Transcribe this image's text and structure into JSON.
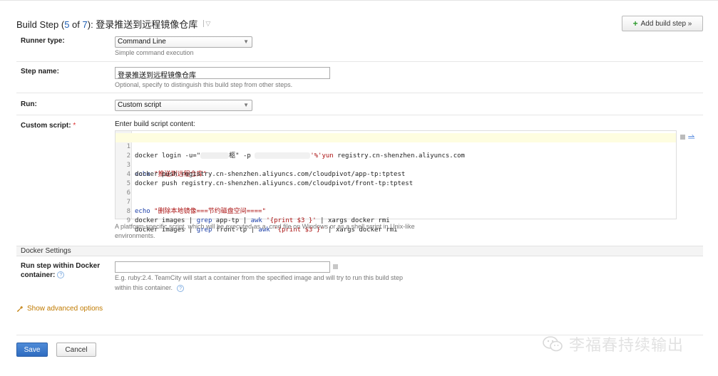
{
  "header": {
    "title_prefix": "Build Step (",
    "current_step": "5",
    "of_text": " of ",
    "total_steps": "7",
    "title_suffix": "): 登录推送到远程镜像仓库"
  },
  "toolbar": {
    "add_build_step_label": "Add build step »"
  },
  "runner_type": {
    "label": "Runner type:",
    "selected": "Command Line",
    "note": "Simple command execution"
  },
  "step_name": {
    "label": "Step name:",
    "value": "登录推送到远程镜像仓库",
    "note": "Optional, specify to distinguish this build step from other steps."
  },
  "run": {
    "label": "Run:",
    "selected": "Custom script"
  },
  "custom_script": {
    "label": "Custom script:",
    "required_mark": "*",
    "editor_label": "Enter build script content:",
    "lines": [
      {
        "n": "1",
        "text": ""
      },
      {
        "n": "2",
        "text": ""
      },
      {
        "n": "3",
        "text": ""
      },
      {
        "n": "4",
        "text": "docker push registry.cn-shenzhen.aliyuncs.com/cloudpivot/app-tp:tptest"
      },
      {
        "n": "5",
        "text": "docker push registry.cn-shenzhen.aliyuncs.com/cloudpivot/front-tp:tptest"
      },
      {
        "n": "6",
        "text": ""
      },
      {
        "n": "7",
        "text": ""
      },
      {
        "n": "8",
        "text": ""
      },
      {
        "n": "9",
        "text": ""
      }
    ],
    "line1": {
      "cmd": "docker login -u=\"",
      "visible_user": "柩\" -p ",
      "tail_quote": "'%'yun",
      "registry": " registry.cn-shenzhen.aliyuncs.com"
    },
    "line3": {
      "cmd": "echo ",
      "str": "\"推送到远程仓库\""
    },
    "line7": {
      "cmd": "echo ",
      "str": "\"删除本地镜像===节约磁盘空间====\""
    },
    "line8": {
      "a": "docker images | ",
      "grep": "grep",
      "b": " app-tp | ",
      "awk": "awk",
      "c": " ",
      "awkstr": "'{print $3 }'",
      "d": " | xargs docker rmi"
    },
    "line9": {
      "a": "docker images | ",
      "grep": "grep",
      "b": " front-tp | ",
      "awk": "awk",
      "c": " ",
      "awkstr": "'{print $3 }'",
      "d": " | xargs docker rmi"
    },
    "note_line1": "A platform-specific script, which will be executed as a .cmd file on Windows or as a shell script in Unix-like",
    "note_line2": "environments."
  },
  "docker": {
    "section_title": "Docker Settings",
    "label_line1": "Run step within Docker",
    "label_line2": "container:",
    "value": "",
    "note_line1": "E.g. ruby:2.4. TeamCity will start a container from the specified image and will try to run this build step",
    "note_line2": "within this container.",
    "help_glyph": "?"
  },
  "advanced": {
    "label": "Show advanced options"
  },
  "footer": {
    "save_label": "Save",
    "cancel_label": "Cancel"
  },
  "watermark": {
    "text": "李福春持续输出"
  },
  "colors": {
    "accent_link": "#1f5fb3",
    "save_button": "#3a78c9",
    "advanced_link": "#c07a00",
    "required": "#dd3333"
  },
  "icons": {
    "select_arrow": "▼",
    "plus": "+",
    "wrench": "wrench-icon",
    "wrap_lines": "⥬"
  }
}
